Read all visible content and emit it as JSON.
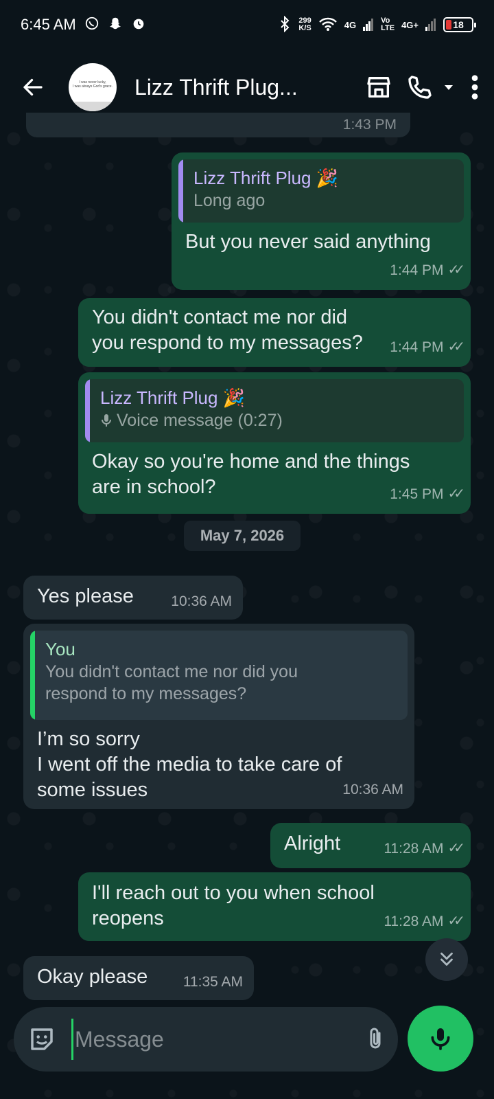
{
  "status_bar": {
    "time": "6:45 AM",
    "net_speed_value": "299",
    "net_speed_unit": "K/S",
    "signal_1": "4G",
    "volte": "Vo\nLTE",
    "signal_2": "4G+",
    "battery": "18"
  },
  "header": {
    "title": "Lizz Thrift Plug...",
    "avatar_text": "I was never lucky,\nI was always God's grace."
  },
  "messages": [
    {
      "quote_author": "Lizz Thrift Plug 🎉",
      "quote_text": "Long ago",
      "text": "But you never said anything",
      "time": "1:44 PM"
    },
    {
      "text": "You didn't contact me nor did you respond to my messages?",
      "time": "1:44 PM"
    },
    {
      "quote_author": "Lizz Thrift Plug 🎉",
      "quote_text": "Voice message (0:27)",
      "text": "Okay so you're home and the things are in school?",
      "time": "1:45 PM"
    },
    {
      "text": "Yes please",
      "time": "10:36 AM"
    },
    {
      "quote_author": "You",
      "quote_text": "You didn't contact me nor did you respond to my messages?",
      "text": "I’m so sorry\nI went off the media to take care of some issues",
      "time": "10:36 AM"
    },
    {
      "text": "Alright",
      "time": "11:28 AM"
    },
    {
      "text": "I'll reach out to you when school reopens",
      "time": "11:28 AM"
    },
    {
      "text": "Okay please",
      "time": "11:35 AM"
    }
  ],
  "date_separator": "May 7, 2026",
  "top_partial_time": "1:43 PM",
  "composer": {
    "placeholder": "Message"
  },
  "colors": {
    "outgoing_bubble": "#144d37",
    "incoming_bubble": "#202c33",
    "accent": "#21c063",
    "background": "#0b141a"
  }
}
